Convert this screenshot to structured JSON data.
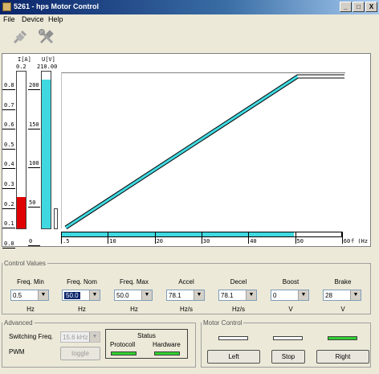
{
  "window": {
    "title": "5261 - hps Motor Control",
    "btn_min": "_",
    "btn_max": "□",
    "btn_close": "X"
  },
  "menu": {
    "file": "File",
    "device": "Device",
    "help": "Help"
  },
  "toolbar": {
    "connect_icon": "plug-icon",
    "tools_icon": "tools-icon"
  },
  "gauges": {
    "current": {
      "header": "I[A]",
      "value": "0.2",
      "scale": [
        "0.8",
        "0.7",
        "0.6",
        "0.5",
        "0.4",
        "0.3",
        "0.2",
        "0.1",
        "0.0"
      ],
      "level_fraction": 0.2,
      "color": "#e00000"
    },
    "voltage": {
      "header": "U[V]",
      "value": "210.00",
      "scale": [
        "200",
        "150",
        "100",
        "50",
        "0"
      ],
      "level_fraction": 0.95,
      "color": "#40d8e0"
    }
  },
  "chart_data": {
    "type": "line",
    "x": [
      0.5,
      50,
      60
    ],
    "y": [
      0,
      100,
      100
    ],
    "xlim": [
      0,
      60
    ],
    "xlabel": "f (Hz",
    "ticks": [
      ".5",
      "10",
      "20",
      "30",
      "40",
      "50",
      "60"
    ],
    "freq_bar_fraction": 0.83,
    "colors": {
      "line": "#40d8e0",
      "bar": "#40d8e0"
    }
  },
  "control_values": {
    "legend": "Control Values",
    "columns": [
      {
        "label": "Freq. Min",
        "value": "0.5",
        "unit": "Hz"
      },
      {
        "label": "Freq. Nom",
        "value": "50.0",
        "unit": "Hz"
      },
      {
        "label": "Freq. Max",
        "value": "50.0",
        "unit": "Hz"
      },
      {
        "label": "Accel",
        "value": "78.1",
        "unit": "Hz/s"
      },
      {
        "label": "Decel",
        "value": "78.1",
        "unit": "Hz/s"
      },
      {
        "label": "Boost",
        "value": "0",
        "unit": "V"
      },
      {
        "label": "Brake",
        "value": "28",
        "unit": "V"
      }
    ]
  },
  "advanced": {
    "legend": "Advanced",
    "switching_label": "Switching Freq.",
    "switching_value": "15.6 kHz",
    "pwm_label": "PWM",
    "toggle_label": "toggle",
    "status_title": "Status",
    "protocoll_label": "Protocoll",
    "hardware_label": "Hardware",
    "led_color": "#30d030"
  },
  "motor_control": {
    "legend": "Motor Control",
    "left_label": "Left",
    "stop_label": "Stop",
    "right_label": "Right",
    "led_colors": [
      "#ffffff",
      "#ffffff",
      "#30d030"
    ]
  }
}
